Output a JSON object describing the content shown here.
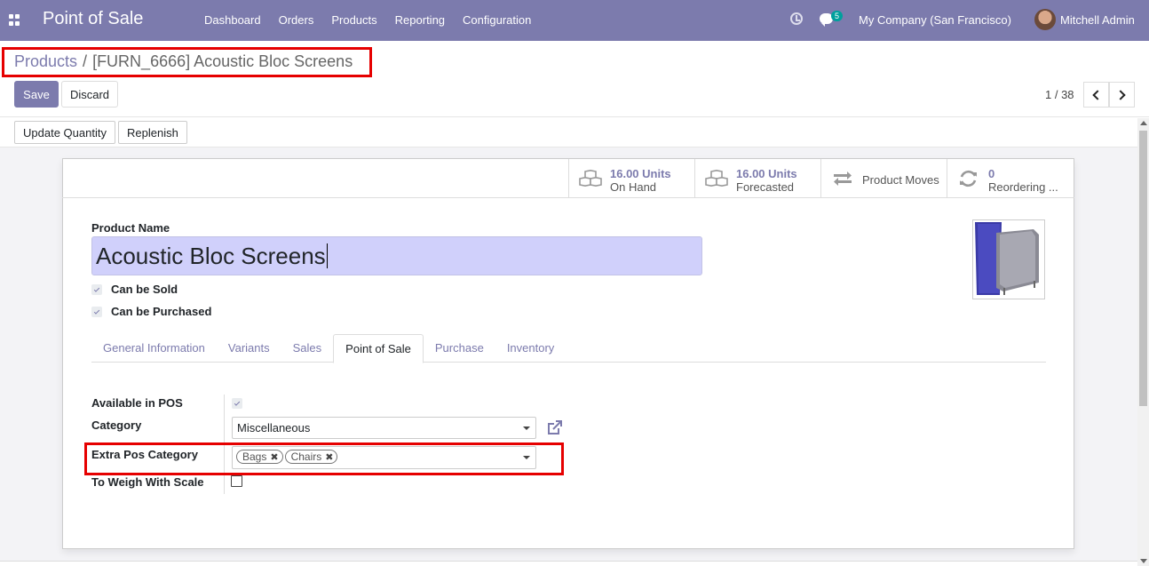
{
  "navbar": {
    "brand": "Point of Sale",
    "menu": [
      "Dashboard",
      "Orders",
      "Products",
      "Reporting",
      "Configuration"
    ],
    "chat_count": "5",
    "company": "My Company (San Francisco)",
    "user": "Mitchell Admin"
  },
  "breadcrumb": {
    "parent": "Products",
    "separator": "/",
    "current": "[FURN_6666] Acoustic Bloc Screens"
  },
  "actions": {
    "save": "Save",
    "discard": "Discard",
    "update_quantity": "Update Quantity",
    "replenish": "Replenish"
  },
  "pager": {
    "value": "1 / 38"
  },
  "stats": {
    "on_hand_value": "16.00 Units",
    "on_hand_label": "On Hand",
    "forecast_value": "16.00 Units",
    "forecast_label": "Forecasted",
    "moves_label": "Product Moves",
    "reorder_value": "0",
    "reorder_label": "Reordering ..."
  },
  "form": {
    "name_label": "Product Name",
    "name_value": "Acoustic Bloc Screens",
    "can_be_sold": "Can be Sold",
    "can_be_purchased": "Can be Purchased"
  },
  "tabs": [
    "General Information",
    "Variants",
    "Sales",
    "Point of Sale",
    "Purchase",
    "Inventory"
  ],
  "pos": {
    "available_label": "Available in POS",
    "category_label": "Category",
    "category_value": "Miscellaneous",
    "extra_label": "Extra Pos Category",
    "extra_tags": [
      "Bags",
      "Chairs"
    ],
    "weigh_label": "To Weigh With Scale"
  },
  "colors": {
    "brand": "#7c7bad",
    "highlight": "#e60000",
    "name_bg": "#d0d0fb"
  }
}
